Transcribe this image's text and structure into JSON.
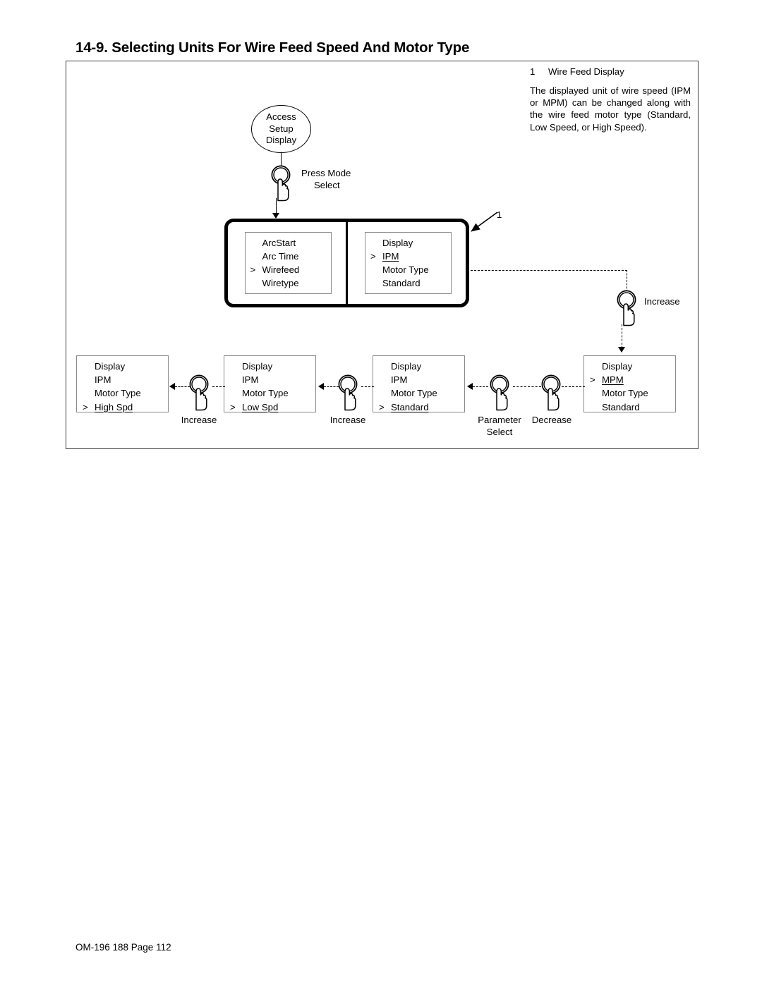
{
  "document": {
    "heading": "14-9. Selecting Units For Wire Feed Speed And Motor Type",
    "footer": "OM-196 188 Page 112"
  },
  "legend": {
    "number": "1",
    "title": "Wire Feed Display",
    "body": "The displayed unit of wire speed (IPM or MPM) can be changed along with the wire feed motor type (Standard, Low Speed, or High Speed)."
  },
  "start_oval": {
    "line1": "Access",
    "line2": "Setup",
    "line3": "Display"
  },
  "buttons": {
    "mode_select": {
      "line1": "Press Mode",
      "line2": "Select"
    },
    "increase_top": {
      "line1": "Increase"
    },
    "increase_mid": {
      "line1": "Increase"
    },
    "increase_left": {
      "line1": "Increase"
    },
    "parameter_select": {
      "line1": "Parameter",
      "line2": "Select"
    },
    "decrease": {
      "line1": "Decrease"
    }
  },
  "panel": {
    "callout": "1",
    "left_screen": {
      "rows": [
        {
          "marker": "",
          "text": "ArcStart",
          "underline": false
        },
        {
          "marker": "",
          "text": "Arc Time",
          "underline": false
        },
        {
          "marker": ">",
          "text": "Wirefeed",
          "underline": false
        },
        {
          "marker": "",
          "text": "Wiretype",
          "underline": false
        }
      ]
    },
    "right_screen": {
      "rows": [
        {
          "marker": "",
          "text": "Display",
          "underline": false
        },
        {
          "marker": ">",
          "text": "IPM",
          "underline": true
        },
        {
          "marker": "",
          "text": "Motor Type",
          "underline": false
        },
        {
          "marker": "",
          "text": "Standard",
          "underline": false
        }
      ]
    }
  },
  "sequence_screens": [
    {
      "id": "high-spd",
      "rows": [
        {
          "marker": "",
          "text": "Display",
          "underline": false
        },
        {
          "marker": "",
          "text": "IPM",
          "underline": false
        },
        {
          "marker": "",
          "text": "Motor Type",
          "underline": false
        },
        {
          "marker": ">",
          "text": "High Spd",
          "underline": true
        }
      ]
    },
    {
      "id": "low-spd",
      "rows": [
        {
          "marker": "",
          "text": "Display",
          "underline": false
        },
        {
          "marker": "",
          "text": "IPM",
          "underline": false
        },
        {
          "marker": "",
          "text": "Motor Type",
          "underline": false
        },
        {
          "marker": ">",
          "text": "Low  Spd",
          "underline": true
        }
      ]
    },
    {
      "id": "standard",
      "rows": [
        {
          "marker": "",
          "text": "Display",
          "underline": false
        },
        {
          "marker": "",
          "text": "IPM",
          "underline": false
        },
        {
          "marker": "",
          "text": "Motor Type",
          "underline": false
        },
        {
          "marker": ">",
          "text": "Standard",
          "underline": true
        }
      ]
    },
    {
      "id": "mpm",
      "rows": [
        {
          "marker": "",
          "text": "Display",
          "underline": false
        },
        {
          "marker": ">",
          "text": "MPM",
          "underline": true
        },
        {
          "marker": "",
          "text": "Motor Type",
          "underline": false
        },
        {
          "marker": "",
          "text": "Standard",
          "underline": false
        }
      ]
    }
  ]
}
